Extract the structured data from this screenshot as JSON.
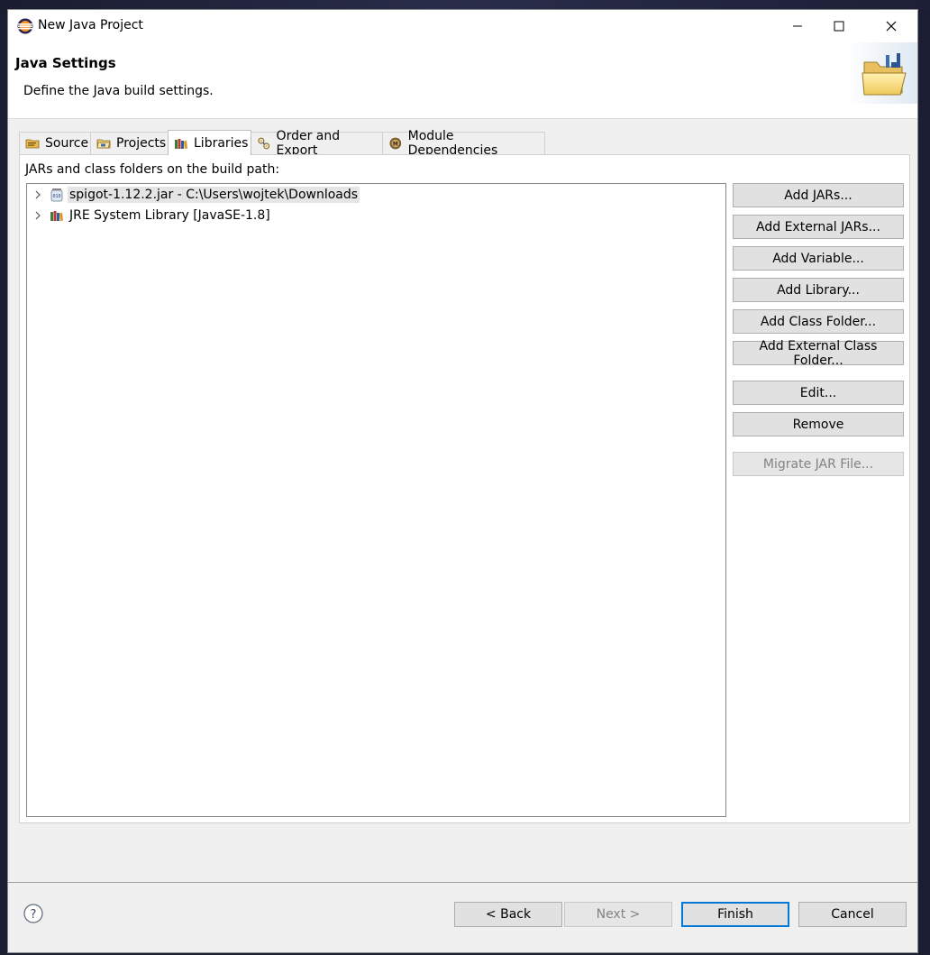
{
  "window": {
    "title": "New Java Project",
    "controls": {
      "minimize": "minimize-icon",
      "maximize": "maximize-icon",
      "close": "close-icon"
    }
  },
  "header": {
    "title": "Java Settings",
    "description": "Define the Java build settings."
  },
  "tabs": [
    {
      "label": "Source",
      "icon": "source-folder-icon",
      "active": false
    },
    {
      "label": "Projects",
      "icon": "projects-icon",
      "active": false
    },
    {
      "label": "Libraries",
      "icon": "libraries-icon",
      "active": true
    },
    {
      "label": "Order and Export",
      "icon": "order-export-icon",
      "active": false
    },
    {
      "label": "Module Dependencies",
      "icon": "module-icon",
      "active": false
    }
  ],
  "libraries": {
    "caption": "JARs and class folders on the build path:",
    "entries": [
      {
        "label": "spigot-1.12.2.jar - C:\\Users\\wojtek\\Downloads",
        "icon": "jar-icon",
        "selected": true
      },
      {
        "label": "JRE System Library [JavaSE-1.8]",
        "icon": "library-icon",
        "selected": false
      }
    ],
    "buttons": {
      "add_jars": "Add JARs...",
      "add_external_jars": "Add External JARs...",
      "add_variable": "Add Variable...",
      "add_library": "Add Library...",
      "add_class_folder": "Add Class Folder...",
      "add_external_class_folder": "Add External Class Folder...",
      "edit": "Edit...",
      "remove": "Remove",
      "migrate_jar": "Migrate JAR File..."
    }
  },
  "footer": {
    "back": "< Back",
    "next": "Next >",
    "finish": "Finish",
    "cancel": "Cancel"
  },
  "colors": {
    "accent": "#0078d7",
    "dialog_bg": "#f0f0f0",
    "selection": "#e5e5e5"
  }
}
